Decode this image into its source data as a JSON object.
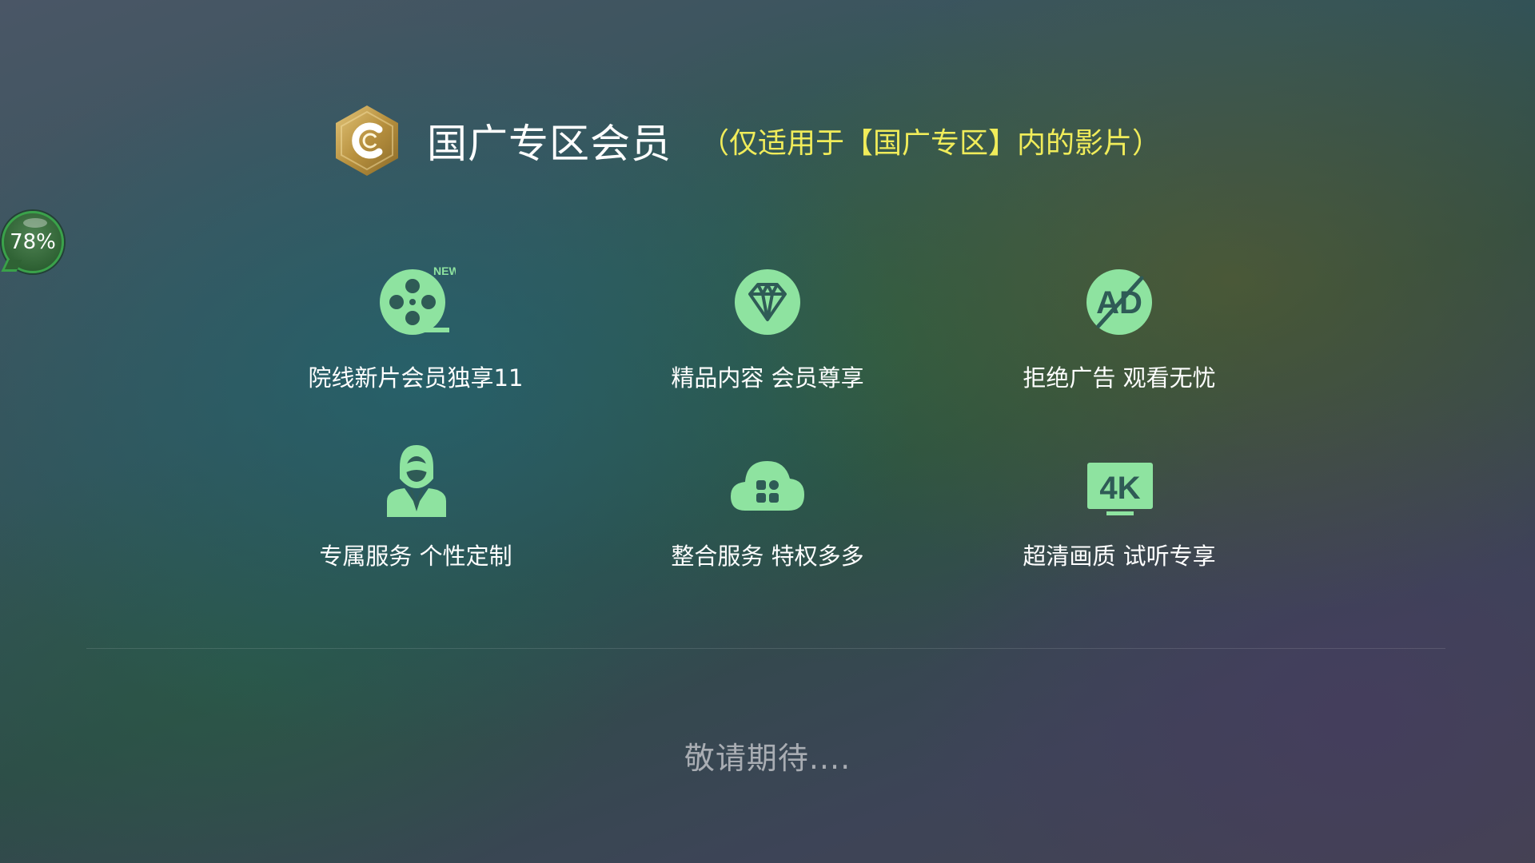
{
  "header": {
    "logo_icon": "gold-hexagon-c-logo",
    "title": "国广专区会员",
    "subtitle": "（仅适用于【国广专区】内的影片）",
    "subtitle_color": "#f0ec5a"
  },
  "progress_badge": {
    "text": "78%",
    "value": 78
  },
  "features": [
    {
      "icon": "film-reel-new-icon",
      "badge": "NEW",
      "label": "院线新片会员独享11"
    },
    {
      "icon": "diamond-icon",
      "label": "精品内容 会员尊享"
    },
    {
      "icon": "no-ad-icon",
      "label": "拒绝广告 观看无忧"
    },
    {
      "icon": "customer-service-icon",
      "label": "专属服务 个性定制"
    },
    {
      "icon": "cloud-apps-icon",
      "label": "整合服务 特权多多"
    },
    {
      "icon": "4k-tv-icon",
      "icon_text": "4K",
      "label": "超清画质 试听专享"
    }
  ],
  "footer": {
    "text": "敬请期待...."
  },
  "colors": {
    "icon_green": "#8ee3a0",
    "footer_text": "#a9adb3"
  }
}
